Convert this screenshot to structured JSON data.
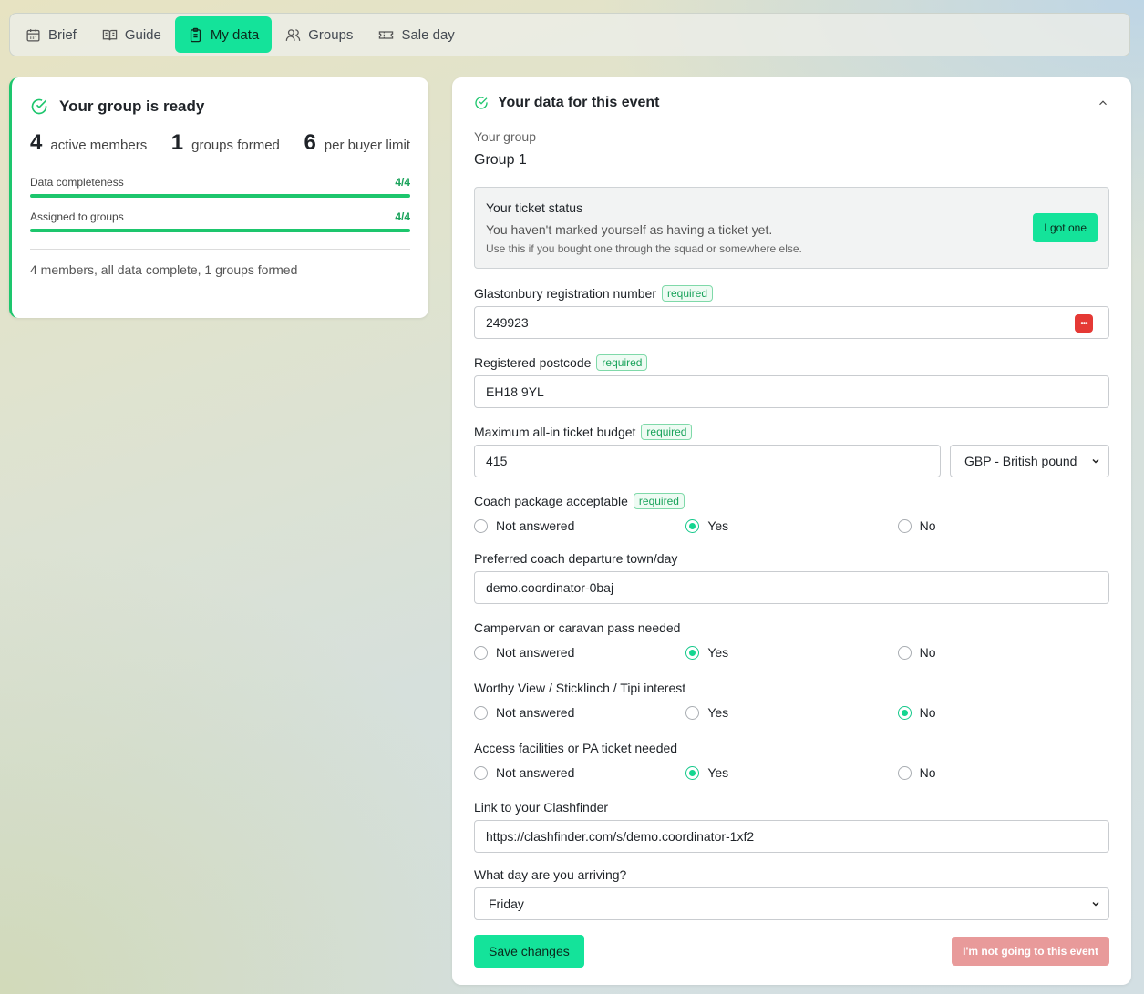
{
  "tabs": [
    {
      "label": "Brief",
      "icon": "calendar-icon"
    },
    {
      "label": "Guide",
      "icon": "book-icon"
    },
    {
      "label": "My data",
      "icon": "clipboard-icon"
    },
    {
      "label": "Groups",
      "icon": "users-icon"
    },
    {
      "label": "Sale day",
      "icon": "ticket-icon"
    }
  ],
  "summary": {
    "title": "Your group is ready",
    "stats": [
      {
        "value": "4",
        "label": "active members"
      },
      {
        "value": "1",
        "label": "groups formed"
      },
      {
        "value": "6",
        "label": "per buyer limit"
      }
    ],
    "bars": [
      {
        "label": "Data completeness",
        "value": "4/4",
        "fill": 1.0
      },
      {
        "label": "Assigned to groups",
        "value": "4/4",
        "fill": 1.0
      }
    ],
    "note": "4 members, all data complete, 1 groups formed"
  },
  "panel": {
    "title": "Your data for this event",
    "group_label": "Your group",
    "group_value": "Group 1",
    "ticket": {
      "title": "Your ticket status",
      "subtitle": "You haven't marked yourself as having a ticket yet.",
      "hint": "Use this if you bought one through the squad or somewhere else.",
      "button": "I got one"
    },
    "required_tag": "required",
    "fields": {
      "reg_number": {
        "label": "Glastonbury registration number",
        "value": "249923"
      },
      "postcode": {
        "label": "Registered postcode",
        "value": "EH18 9YL"
      },
      "budget": {
        "label": "Maximum all-in ticket budget",
        "value": "415",
        "currency": "GBP - British pound"
      },
      "coach": {
        "label": "Coach package acceptable"
      },
      "coach_town": {
        "label": "Preferred coach departure town/day",
        "value": "demo.coordinator-0baj"
      },
      "campervan": {
        "label": "Campervan or caravan pass needed"
      },
      "worthy": {
        "label": "Worthy View / Sticklinch / Tipi interest"
      },
      "access": {
        "label": "Access facilities or PA ticket needed"
      },
      "clashfinder": {
        "label": "Link to your Clashfinder",
        "value": "https://clashfinder.com/s/demo.coordinator-1xf2"
      },
      "arrival": {
        "label": "What day are you arriving?",
        "value": "Friday"
      }
    },
    "radio_options": [
      "Not answered",
      "Yes",
      "No"
    ],
    "radio_selected": {
      "coach": "Yes",
      "campervan": "Yes",
      "worthy": "No",
      "access": "Yes"
    },
    "save_button": "Save changes",
    "not_going_button": "I'm not going to this event"
  },
  "colors": {
    "accent": "#14e39a",
    "success": "#1dc66d",
    "danger": "#e89a9a"
  }
}
